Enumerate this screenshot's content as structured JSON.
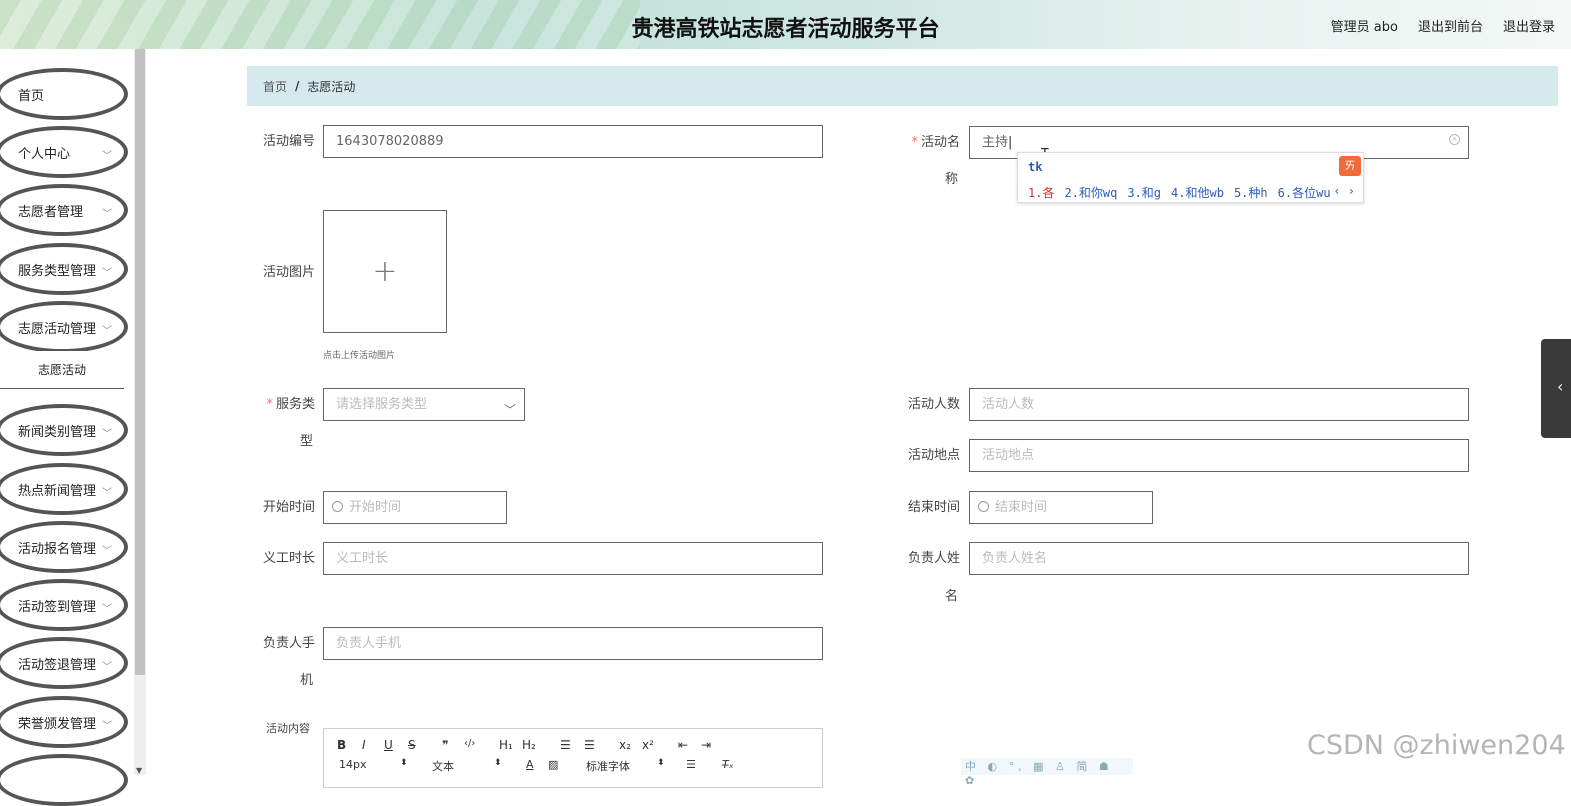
{
  "header": {
    "title": "贵港高铁站志愿者活动服务平台",
    "user_label": "管理员 abo",
    "to_front": "退出到前台",
    "logout": "退出登录"
  },
  "sidebar": {
    "items": [
      {
        "label": "首页"
      },
      {
        "label": "个人中心"
      },
      {
        "label": "志愿者管理"
      },
      {
        "label": "服务类型管理"
      },
      {
        "label": "志愿活动管理"
      },
      {
        "label": "新闻类别管理"
      },
      {
        "label": "热点新闻管理"
      },
      {
        "label": "活动报名管理"
      },
      {
        "label": "活动签到管理"
      },
      {
        "label": "活动签退管理"
      },
      {
        "label": "荣誉颁发管理"
      }
    ],
    "sub_item": "志愿活动"
  },
  "breadcrumb": {
    "home": "首页",
    "sep": "/",
    "current": "志愿活动"
  },
  "form": {
    "activity_no": {
      "label": "活动编号",
      "value": "1643078020889"
    },
    "activity_name": {
      "label_a": "活动名",
      "label_b": "称",
      "value": "主持"
    },
    "activity_image": {
      "label": "活动图片",
      "hint": "点击上传活动图片",
      "plus": "+"
    },
    "service_type": {
      "label_a": "服务类",
      "label_b": "型",
      "placeholder": "请选择服务类型"
    },
    "count": {
      "label": "活动人数",
      "placeholder": "活动人数"
    },
    "place": {
      "label": "活动地点",
      "placeholder": "活动地点"
    },
    "start": {
      "label": "开始时间",
      "placeholder": "开始时间"
    },
    "end": {
      "label": "结束时间",
      "placeholder": "结束时间"
    },
    "hours": {
      "label": "义工时长",
      "placeholder": "义工时长"
    },
    "leader_name": {
      "label_a": "负责人姓",
      "label_b": "名",
      "placeholder": "负责人姓名"
    },
    "leader_phone": {
      "label_a": "负责人手",
      "label_b": "机",
      "placeholder": "负责人手机"
    },
    "content": {
      "label": "活动内容"
    }
  },
  "editor_toolbar": {
    "row1": [
      "B",
      "I",
      "U",
      "S",
      "❞",
      "‹/›",
      "H₁",
      "H₂",
      "☰",
      "☰",
      "x₂",
      "x²",
      "⇤",
      "⇥"
    ],
    "size": "14px",
    "header": "文本",
    "font": "标准字体"
  },
  "ime": {
    "typed": "tk",
    "candidates": [
      "1.各",
      "2.和你wq",
      "3.和g",
      "4.和他wb",
      "5.种h",
      "6.各位wu"
    ],
    "nav": "‹ ›"
  },
  "watermark": "CSDN @zhiwen204",
  "ime_bar": "中 ◐ °, ▦ ♙ 简 ☗ ✿"
}
